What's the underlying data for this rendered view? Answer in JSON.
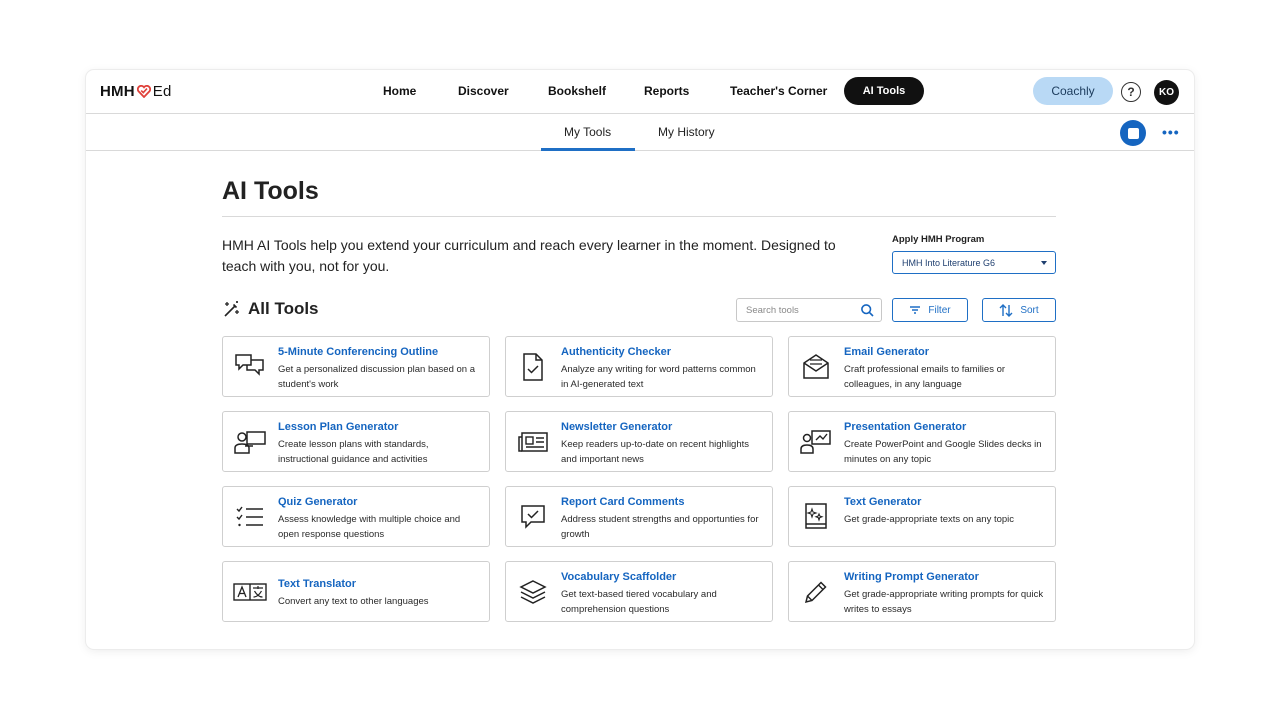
{
  "brand": {
    "logo_left": "HMH",
    "logo_right": "Ed",
    "accent": "#1565c0",
    "heart_color": "#e0413a"
  },
  "topnav": {
    "items": [
      "Home",
      "Discover",
      "Bookshelf",
      "Reports",
      "Teacher's Corner"
    ],
    "active": "AI Tools",
    "coachly": "Coachly",
    "help_icon": "?",
    "avatar_initials": "KO"
  },
  "subnav": {
    "tabs": [
      "My Tools",
      "My History"
    ],
    "active_tab": "My Tools",
    "more": "•••"
  },
  "page": {
    "title": "AI Tools",
    "intro": "HMH AI Tools help you extend your curriculum and reach every learner in the moment. Designed to teach with you, not for you.",
    "program_label": "Apply HMH Program",
    "program_value": "HMH Into Literature G6"
  },
  "tools_section": {
    "title": "All Tools",
    "search_placeholder": "Search tools",
    "filter_label": "Filter",
    "sort_label": "Sort"
  },
  "tools": [
    {
      "title": "5-Minute Conferencing Outline",
      "desc": "Get a personalized discussion plan based on a student's work",
      "icon": "chat-bubbles-icon"
    },
    {
      "title": "Authenticity Checker",
      "desc": "Analyze any writing for word patterns common in AI-generated text",
      "icon": "document-check-icon"
    },
    {
      "title": "Email Generator",
      "desc": "Craft professional emails to families or colleagues, in any language",
      "icon": "envelope-icon"
    },
    {
      "title": "Lesson Plan Generator",
      "desc": "Create lesson plans with standards, instructional guidance and activities",
      "icon": "teacher-board-icon"
    },
    {
      "title": "Newsletter Generator",
      "desc": "Keep readers up-to-date on recent highlights and important news",
      "icon": "newspaper-icon"
    },
    {
      "title": "Presentation Generator",
      "desc": "Create PowerPoint and Google Slides decks in minutes on any topic",
      "icon": "presentation-icon"
    },
    {
      "title": "Quiz Generator",
      "desc": "Assess knowledge with multiple choice and open response questions",
      "icon": "checklist-icon"
    },
    {
      "title": "Report Card Comments",
      "desc": "Address student strengths and opportunties for growth",
      "icon": "comment-check-icon"
    },
    {
      "title": "Text Generator",
      "desc": "Get grade-appropriate texts on any topic",
      "icon": "sparkle-book-icon"
    },
    {
      "title": "Text Translator",
      "desc": "Convert any text to other languages",
      "icon": "translate-icon"
    },
    {
      "title": "Vocabulary Scaffolder",
      "desc": "Get text-based tiered vocabulary and comprehension questions",
      "icon": "layers-icon"
    },
    {
      "title": "Writing Prompt Generator",
      "desc": "Get grade-appropriate writing prompts for quick writes to essays",
      "icon": "pencil-icon"
    }
  ]
}
